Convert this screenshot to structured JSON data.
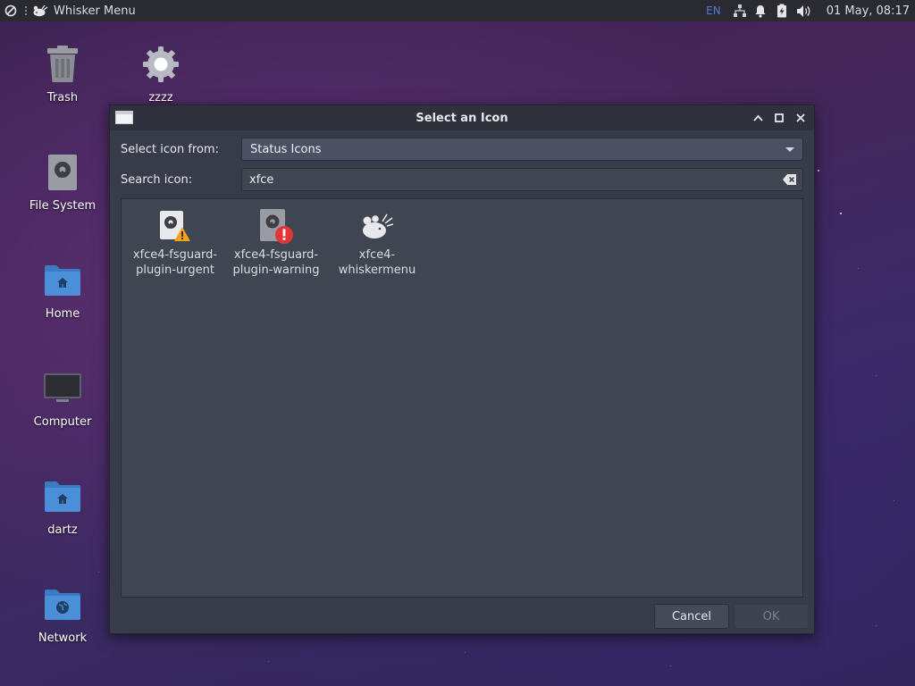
{
  "panel": {
    "app_menu_label": "Whisker Menu",
    "keyboard_layout": "EN",
    "clock": "01 May, 08:17",
    "icons": [
      "action-menu-icon",
      "xfce-mouse-icon",
      "network-icon",
      "notification-bell-icon",
      "battery-icon",
      "volume-icon"
    ]
  },
  "desktop": {
    "icons": [
      {
        "label": "Trash",
        "icon": "trash-icon"
      },
      {
        "label": "zzzz",
        "icon": "gear-icon"
      },
      {
        "label": "File System",
        "icon": "drive-icon"
      },
      {
        "label": "Home",
        "icon": "home-folder-icon"
      },
      {
        "label": "Computer",
        "icon": "monitor-icon"
      },
      {
        "label": "dartz",
        "icon": "home-folder-icon"
      },
      {
        "label": "Network",
        "icon": "network-folder-icon"
      }
    ]
  },
  "dialog": {
    "title": "Select an Icon",
    "select_from_label": "Select icon from:",
    "select_from_value": "Status Icons",
    "search_label": "Search icon:",
    "search_value": "xfce",
    "results": [
      {
        "label": "xfce4-fsguard-plugin-urgent",
        "line1": "xfce4-fsguard-",
        "line2": "plugin-urgent",
        "icon": "drive-warning-icon"
      },
      {
        "label": "xfce4-fsguard-plugin-warning",
        "line1": "xfce4-fsguard-",
        "line2": "plugin-warning",
        "icon": "drive-error-icon"
      },
      {
        "label": "xfce4-whiskermenu",
        "line1": "xfce4-",
        "line2": "whiskermenu",
        "icon": "xfce-mouse-icon"
      }
    ],
    "cancel_label": "Cancel",
    "ok_label": "OK"
  },
  "colors": {
    "panel_bg": "#2a2b31",
    "dialog_bg": "#383c4a",
    "folder_blue": "#4a8fd8",
    "warning_orange": "#f2a11d",
    "error_red": "#e0363a",
    "lang_blue": "#5b74d8"
  }
}
